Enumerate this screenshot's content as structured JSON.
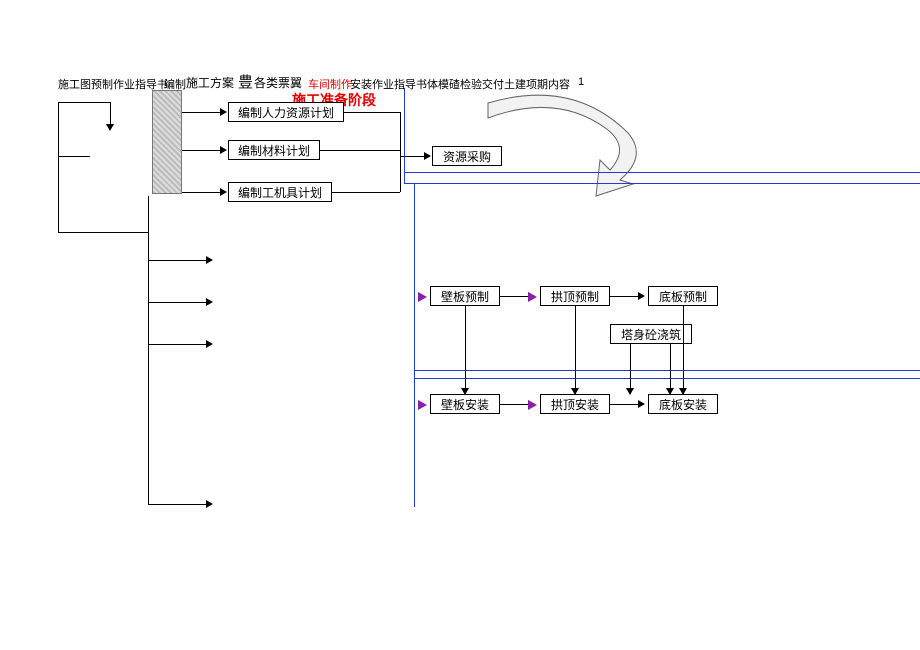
{
  "header": {
    "seg1": "施工图预制作业指导书",
    "seg2": "编制",
    "seg3": "施工方案",
    "seg4": "豊",
    "seg5": "各类票翼",
    "seg6_red": "车间制作",
    "seg7": "安装作业指导书体模碴检验交付土建项期内容",
    "seg8": "1"
  },
  "title_red": "施工准备阶段",
  "left_boxes": {
    "a": "编制人力资源计划",
    "b": "编制材料计划",
    "c": "编制工机具计划"
  },
  "right_top": "资源采购",
  "lower": {
    "r1a": "壁板预制",
    "r1b": "拱顶预制",
    "r1c": "底板预制",
    "mid": "塔身砼浇筑",
    "r2a": "壁板安装",
    "r2b": "拱顶安装",
    "r2c": "底板安装"
  }
}
